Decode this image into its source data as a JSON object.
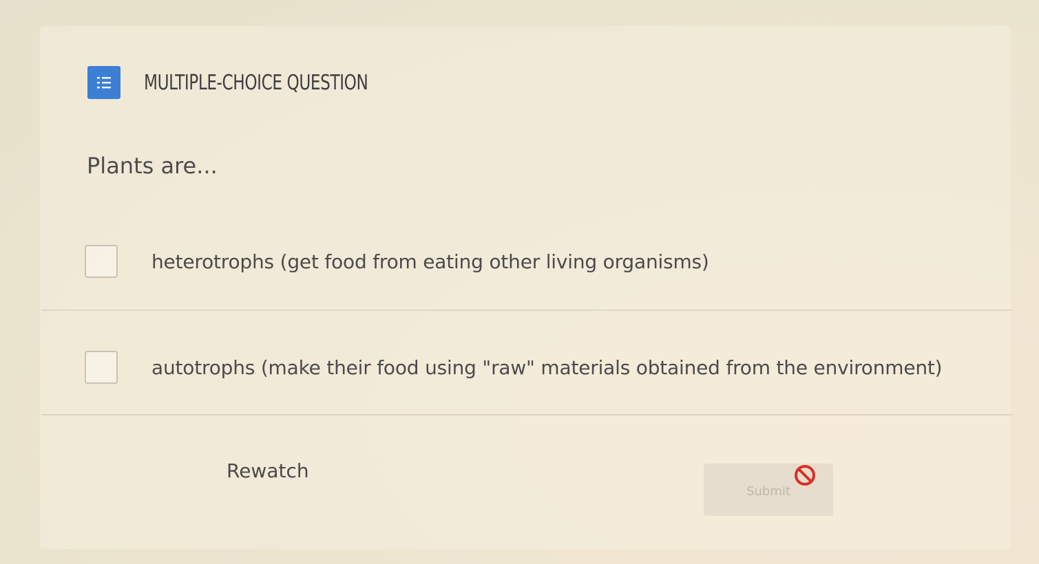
{
  "question": {
    "type_label": "MULTIPLE-CHOICE QUESTION",
    "type_icon": "list-icon",
    "prompt": "Plants are...",
    "options": [
      {
        "label": "heterotrophs (get food from eating other living organisms)",
        "checked": false
      },
      {
        "label": "autotrophs (make their food using \"raw\" materials obtained from the environment)",
        "checked": false
      }
    ]
  },
  "actions": {
    "rewatch_label": "Rewatch",
    "submit_label": "Submit",
    "submit_disabled": true,
    "disabled_icon": "not-allowed-icon"
  },
  "colors": {
    "accent": "#3d7fd4",
    "disabled": "#d93025"
  }
}
